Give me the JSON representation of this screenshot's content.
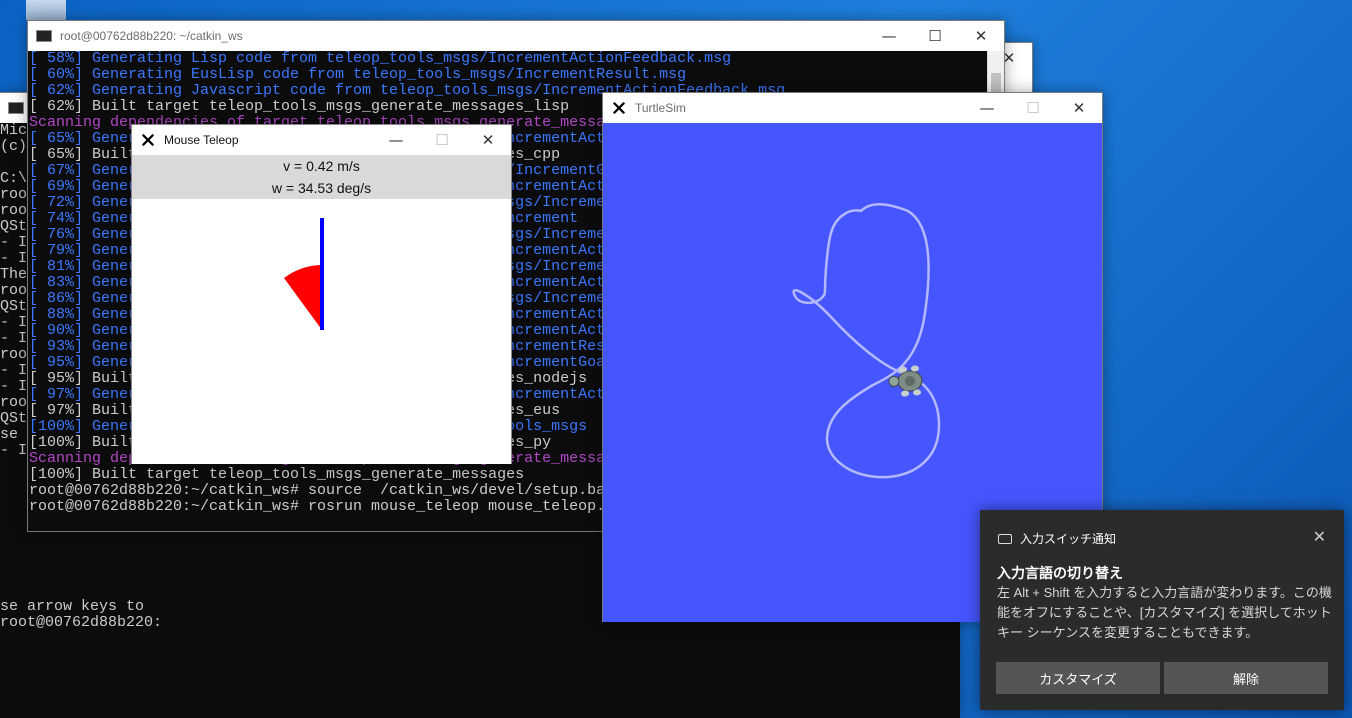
{
  "catkin_window": {
    "title": "root@00762d88b220: ~/catkin_ws",
    "lines": [
      {
        "text": "[ 58%] Generating Lisp code from teleop_tools_msgs/IncrementActionFeedback.msg",
        "style": "blue"
      },
      {
        "text": "[ 60%] Generating EusLisp code from teleop_tools_msgs/IncrementResult.msg",
        "style": "blue"
      },
      {
        "text": "[ 62%] Generating Javascript code from teleop_tools_msgs/IncrementActionFeedback.msg",
        "style": "blue"
      },
      {
        "text": "[ 62%] Built target teleop_tools_msgs_generate_messages_lisp",
        "style": "white"
      },
      {
        "text": "Scanning dependencies of target teleop_tools_msgs_generate_messages_py",
        "style": "mag"
      },
      {
        "text": "[ 65%] Generating Python from MSG teleop_tools_msgs/IncrementActionFeedback",
        "style": "blue"
      },
      {
        "text": "[ 65%] Built target teleop_tools_msgs_generate_messages_cpp",
        "style": "white"
      },
      {
        "text": "[ 67%] Generating EusLisp code from teleop_tools_msgs/IncrementGoal.msg",
        "style": "blue"
      },
      {
        "text": "[ 69%] Generating Python from MSG teleop_tools_msgs/IncrementActionFeedback",
        "style": "blue"
      },
      {
        "text": "[ 72%] Generating Javascript code from teleop_tools_msgs/IncrementActionResult.msg",
        "style": "blue"
      },
      {
        "text": "[ 74%] Generating Python from MSG teleop_tools_msgs/Increment",
        "style": "blue"
      },
      {
        "text": "[ 76%] Generating Javascript code from teleop_tools_msgs/IncrementAction.msg",
        "style": "blue"
      },
      {
        "text": "[ 79%] Generating Python from MSG teleop_tools_msgs/IncrementActionGoal",
        "style": "blue"
      },
      {
        "text": "[ 81%] Generating Javascript code from teleop_tools_msgs/IncrementResult.msg",
        "style": "blue"
      },
      {
        "text": "[ 83%] Generating Python from MSG teleop_tools_msgs/IncrementActionResult",
        "style": "blue"
      },
      {
        "text": "[ 86%] Generating Javascript code from teleop_tools_msgs/IncrementGoal.msg",
        "style": "blue"
      },
      {
        "text": "[ 88%] Generating Python from MSG teleop_tools_msgs/IncrementActionFeedback",
        "style": "blue"
      },
      {
        "text": "[ 90%] Generating Python from MSG teleop_tools_msgs/IncrementAction",
        "style": "blue"
      },
      {
        "text": "[ 93%] Generating Python from MSG teleop_tools_msgs/IncrementResult",
        "style": "blue"
      },
      {
        "text": "[ 95%] Generating Python from MSG teleop_tools_msgs/IncrementGoal",
        "style": "blue"
      },
      {
        "text": "[ 95%] Built target teleop_tools_msgs_generate_messages_nodejs",
        "style": "white"
      },
      {
        "text": "[ 97%] Generating Python from MSG teleop_tools_msgs/IncrementActionFeedback",
        "style": "blue"
      },
      {
        "text": "[ 97%] Built target teleop_tools_msgs_generate_messages_eus",
        "style": "white"
      },
      {
        "text": "[100%] Generating Python msg __init__.py for teleop_tools_msgs",
        "style": "blue"
      },
      {
        "text": "[100%] Built target teleop_tools_msgs_generate_messages_py",
        "style": "white"
      },
      {
        "text": "Scanning dependencies of target teleop_tools_msgs_generate_messages",
        "style": "mag"
      },
      {
        "text": "[100%] Built target teleop_tools_msgs_generate_messages",
        "style": "white"
      },
      {
        "text": "root@00762d88b220:~/catkin_ws# source  /catkin_ws/devel/setup.bash",
        "style": "white"
      },
      {
        "text": "root@00762d88b220:~/catkin_ws# rosrun mouse_teleop mouse_teleop.py mouse_vel:=turtle1/cmd_vel",
        "style": "white"
      }
    ]
  },
  "bg_console": {
    "lines": [
      "Micr",
      "(c)",
      "",
      "C:\\U",
      "root",
      "root",
      "QSta",
      "- IN",
      "- IN",
      "The",
      "root",
      "QSta",
      "- IN",
      "- IN",
      "root",
      "- IN",
      "- IN",
      "root",
      "QSta",
      "se",
      "- IN"
    ],
    "bottom_lines": [
      "se arrow keys to",
      "root@00762d88b220:"
    ]
  },
  "teleop_window": {
    "title": "Mouse Teleop",
    "linear": "v = 0.42 m/s",
    "angular": "w = 34.53 deg/s"
  },
  "turtlesim_window": {
    "title": "TurtleSim"
  },
  "toast": {
    "app_name": "入力スイッチ通知",
    "title": "入力言語の切り替え",
    "body": "左 Alt + Shift を入力すると入力言語が変わります。この機能をオフにすることや、[カスタマイズ] を選択してホットキー シーケンスを変更することもできます。",
    "button_customize": "カスタマイズ",
    "button_dismiss": "解除"
  },
  "window_controls": {
    "minimize": "—",
    "maximize": "☐",
    "close": "✕"
  }
}
